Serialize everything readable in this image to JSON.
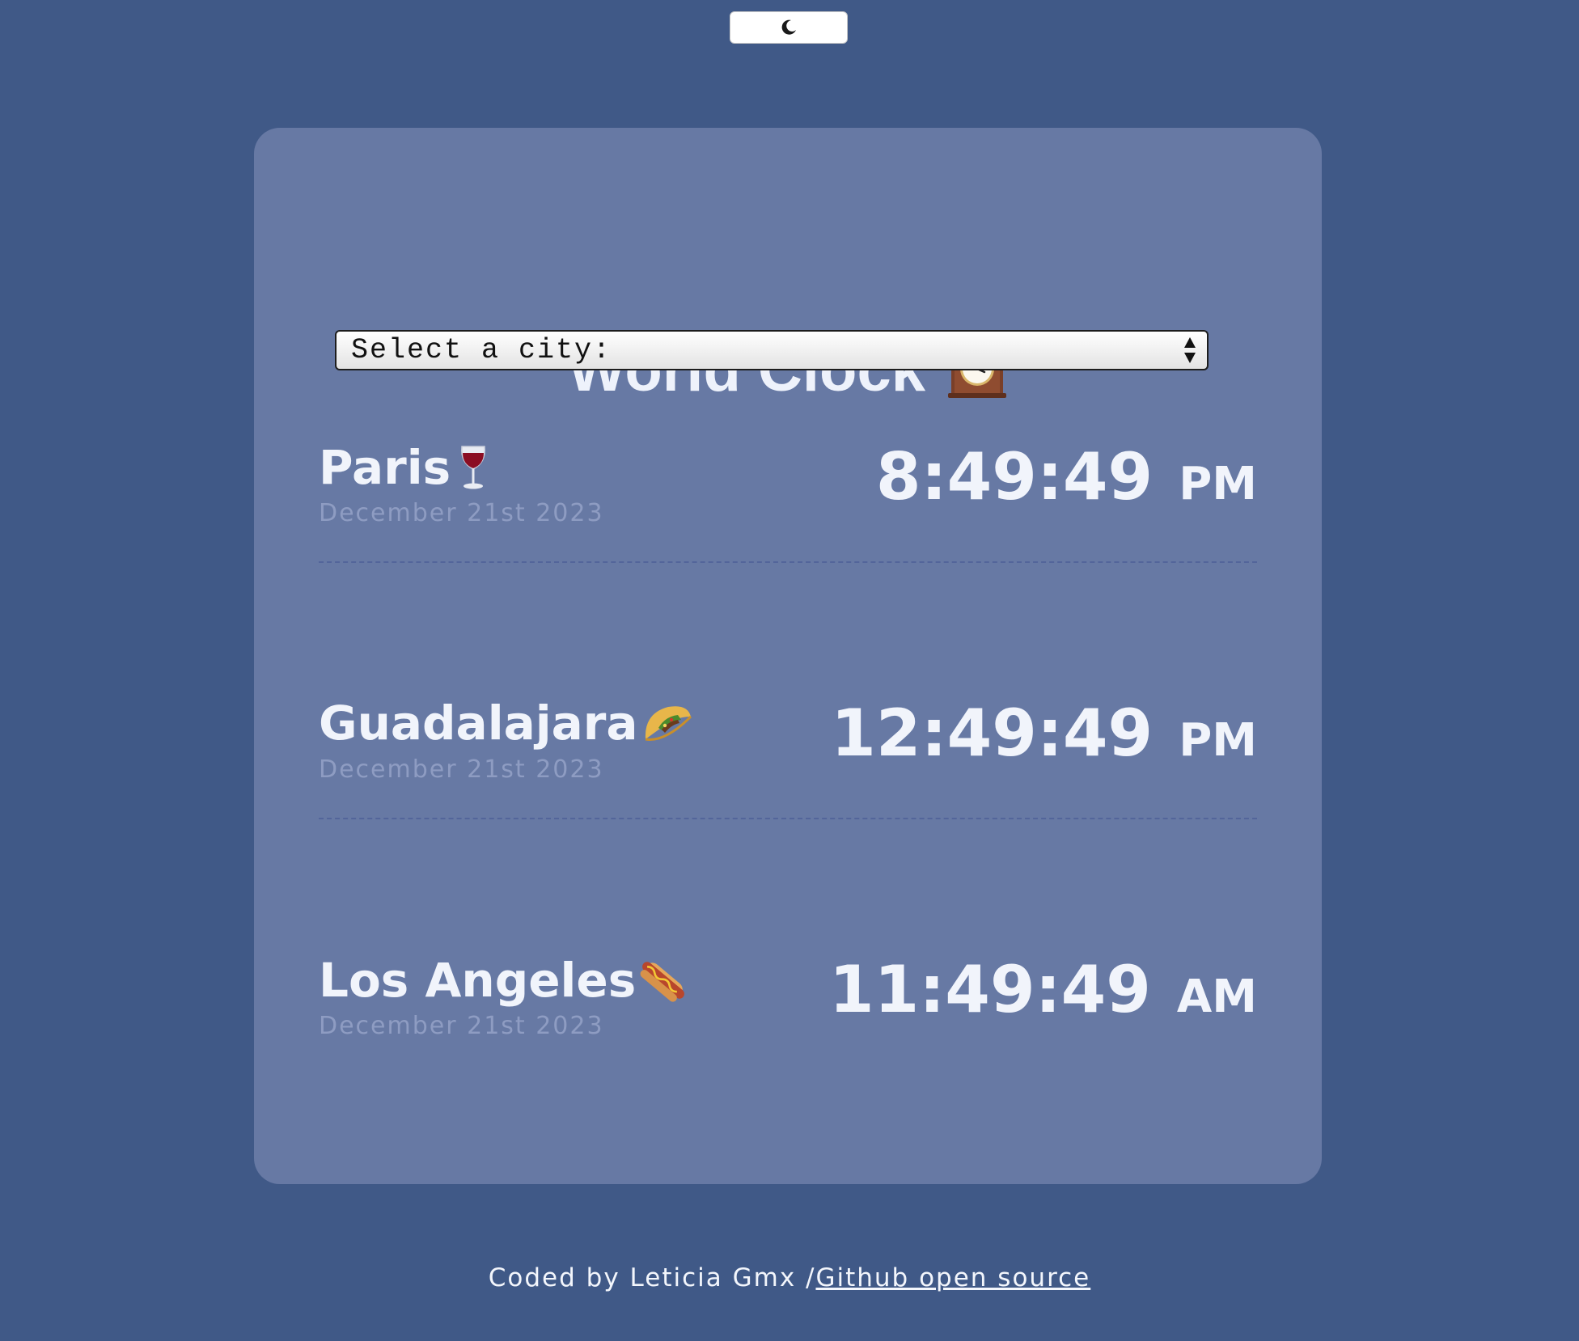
{
  "header": {
    "theme_toggle_icon": "moon-icon"
  },
  "app": {
    "title": "World Clock",
    "title_icon": "mantelpiece-clock-icon"
  },
  "city_select": {
    "placeholder": "Select a city:"
  },
  "cities": [
    {
      "name": "Paris",
      "emoji_icon": "wine-glass-icon",
      "date": "December 21st 2023",
      "time": "8:49:49",
      "ampm": "PM"
    },
    {
      "name": "Guadalajara",
      "emoji_icon": "taco-icon",
      "date": "December 21st 2023",
      "time": "12:49:49",
      "ampm": "PM"
    },
    {
      "name": "Los Angeles",
      "emoji_icon": "hot-dog-icon",
      "date": "December 21st 2023",
      "time": "11:49:49",
      "ampm": "AM"
    }
  ],
  "footer": {
    "text": "Coded by Leticia Gmx /",
    "link_text": "Github open source"
  },
  "colors": {
    "page_background": "#405987",
    "card_background": "#6779a4",
    "primary_text": "#f1f4fb",
    "date_text": "#8e9cc2"
  }
}
